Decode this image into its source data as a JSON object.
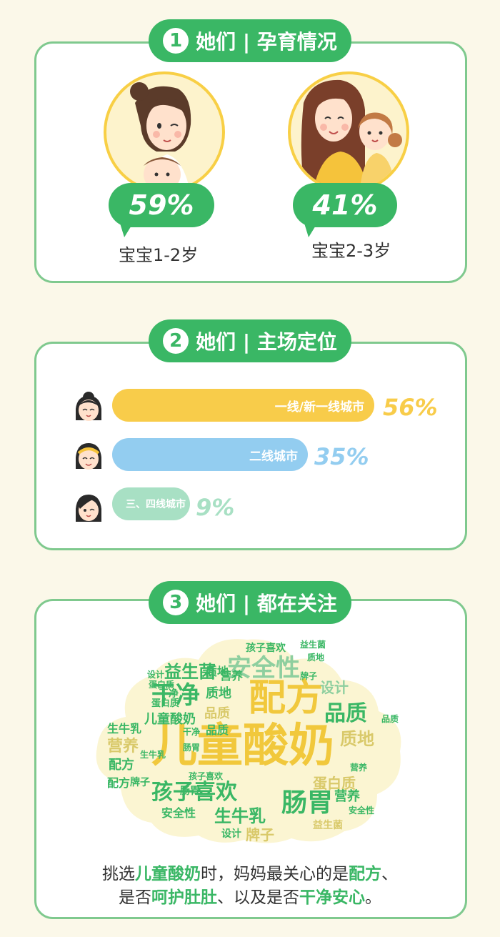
{
  "sections": [
    {
      "num": "1",
      "title": "她们 | 孕育情况"
    },
    {
      "num": "2",
      "title": "她们 | 主场定位"
    },
    {
      "num": "3",
      "title": "她们 | 都在关注"
    }
  ],
  "parenting": [
    {
      "pct": "59%",
      "label": "宝宝1-2岁",
      "value": 59
    },
    {
      "pct": "41%",
      "label": "宝宝2-3岁",
      "value": 41
    }
  ],
  "cities": [
    {
      "label": "一线/新一线城市",
      "pct": "56%",
      "value": 56,
      "bar_color": "#f8cc4a",
      "pct_color": "#f8cc4a"
    },
    {
      "label": "二线城市",
      "pct": "35%",
      "value": 35,
      "bar_color": "#93cdf0",
      "pct_color": "#93cdf0"
    },
    {
      "label": "三、四线城市",
      "pct": "9%",
      "value": 9,
      "bar_color": "#a8e0c4",
      "pct_color": "#a8e0c4"
    }
  ],
  "word_cloud": [
    "儿童酸奶",
    "配方",
    "孩子喜欢",
    "肠胃",
    "干净",
    "安全性",
    "益生菌",
    "品质",
    "质地",
    "营养",
    "生牛乳",
    "设计",
    "蛋白质",
    "牌子",
    "儿童酸奶",
    "品质",
    "质地",
    "营养",
    "配方",
    "肠胃",
    "干净",
    "蛋白质",
    "安全性",
    "生牛乳",
    "牌子",
    "设计",
    "孩子喜欢",
    "益生菌",
    "质地",
    "品质",
    "营养",
    "配方",
    "干净",
    "牌子",
    "设计",
    "蛋白质",
    "安全性",
    "生牛乳",
    "益生菌",
    "孩子喜欢",
    "肠胃",
    "质地",
    "品质",
    "营养"
  ],
  "conclusion": {
    "line1": [
      "挑选",
      "儿童酸奶",
      "时，妈妈最关心的是",
      "配方",
      "、"
    ],
    "line2": [
      "是否",
      "呵护肚肚",
      "、以及是否",
      "干净安心",
      "。"
    ]
  },
  "colors": {
    "green": "#3ab765",
    "border": "#7fc98e",
    "yellow": "#f8cc4a",
    "blue": "#93cdf0",
    "mint": "#a8e0c4",
    "background": "#fbf8e9"
  }
}
